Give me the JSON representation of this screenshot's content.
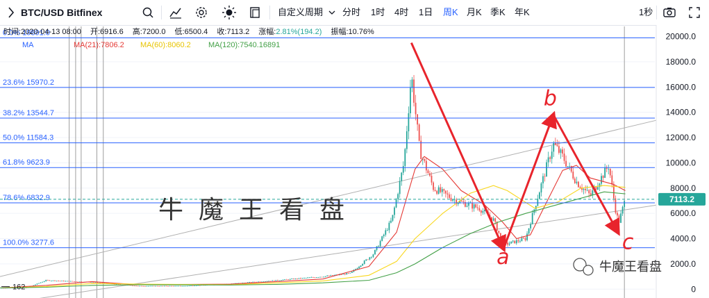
{
  "toolbar": {
    "symbol": "BTC/USD Bitfinex",
    "custom_period": "自定义周期",
    "periods": [
      "分时",
      "1时",
      "4时",
      "1日",
      "周K",
      "月K",
      "季K",
      "年K"
    ],
    "active_period": "周K",
    "interval": "1秒",
    "icons": [
      "search-icon",
      "indicator-icon",
      "settings-icon",
      "theme-icon",
      "layout-icon",
      "camera-icon",
      "fullscreen-icon"
    ]
  },
  "info_line": {
    "time_label": "时间:",
    "time": "2020-04-13 08:00",
    "open_label": "开:",
    "open": "6916.6",
    "high_label": "高:",
    "high": "7200.0",
    "low_label": "低:",
    "low": "6500.4",
    "close_label": "收:",
    "close": "7113.2",
    "change_label": "涨幅:",
    "change": "2.81%(194.2)",
    "amplitude_label": "振幅:",
    "amplitude": "10.76%"
  },
  "ma_line": {
    "ma": "MA",
    "ma21": "MA(21):7806.2",
    "ma60": "MA(60):8060.2",
    "ma120": "MA(120):7540.16891"
  },
  "watermark": "牛魔王看盘",
  "brand": "牛魔王看盘",
  "colors": {
    "up": "#26a69a",
    "down": "#ef5350",
    "fib": "#2962ff",
    "ma21": "#e53935",
    "ma60": "#f9d71c",
    "ma120": "#43a047",
    "arrow": "#e8242c",
    "price_tag": "#26a69a"
  },
  "chart_data": {
    "type": "candlestick",
    "title": "BTC/USD Bitfinex",
    "y_ticks": [
      0,
      2000,
      4000,
      6000,
      8000,
      10000,
      12000,
      14000,
      16000,
      18000,
      20000
    ],
    "y_tick_labels": [
      "0",
      "2000.0",
      "4000.0",
      "6000.0",
      "8000.0",
      "10000.0",
      "12000.0",
      "14000.0",
      "16000.0",
      "18000.0",
      "20000.0"
    ],
    "ylim": [
      -700,
      20800
    ],
    "xlim": [
      2013.5,
      2020.6
    ],
    "last_price": 7113.2,
    "last_price_label": "7113.2",
    "low_marker_label": "162",
    "fib_levels": [
      {
        "label": "0.0% 19891.0",
        "value": 19891.0
      },
      {
        "label": "23.6% 15970.2",
        "value": 15970.2
      },
      {
        "label": "38.2% 13544.7",
        "value": 13544.7
      },
      {
        "label": "50.0% 11584.3",
        "value": 11584.3
      },
      {
        "label": "61.8% 9623.9",
        "value": 9623.9
      },
      {
        "label": "78.6% 6832.9",
        "value": 6832.9
      },
      {
        "label": "100.0% 3277.6",
        "value": 3277.6
      }
    ],
    "waves": [
      {
        "label": "a",
        "from": [
          2017.96,
          19500
        ],
        "to": [
          2018.96,
          3200
        ]
      },
      {
        "label": "b",
        "from": [
          2018.96,
          3200
        ],
        "to": [
          2019.5,
          13800
        ]
      },
      {
        "label": "c",
        "from": [
          2019.5,
          13800
        ],
        "to": [
          2020.2,
          4500
        ]
      }
    ],
    "price_path": [
      [
        2013.5,
        100
      ],
      [
        2013.8,
        130
      ],
      [
        2014.0,
        700
      ],
      [
        2014.5,
        550
      ],
      [
        2015.0,
        250
      ],
      [
        2015.5,
        250
      ],
      [
        2016.0,
        430
      ],
      [
        2016.5,
        700
      ],
      [
        2017.0,
        1000
      ],
      [
        2017.3,
        1250
      ],
      [
        2017.55,
        2800
      ],
      [
        2017.75,
        5500
      ],
      [
        2017.88,
        10000
      ],
      [
        2017.96,
        17000
      ],
      [
        2018.05,
        11000
      ],
      [
        2018.2,
        8000
      ],
      [
        2018.45,
        7000
      ],
      [
        2018.7,
        6400
      ],
      [
        2018.85,
        5500
      ],
      [
        2018.96,
        3500
      ],
      [
        2019.2,
        4000
      ],
      [
        2019.35,
        7800
      ],
      [
        2019.5,
        11500
      ],
      [
        2019.6,
        10500
      ],
      [
        2019.75,
        8500
      ],
      [
        2019.9,
        7400
      ],
      [
        2020.0,
        8600
      ],
      [
        2020.1,
        9800
      ],
      [
        2020.18,
        6000
      ],
      [
        2020.21,
        5300
      ],
      [
        2020.28,
        7113.2
      ]
    ],
    "series": [
      {
        "name": "MA(21)",
        "color": "#e53935",
        "points": [
          [
            2013.5,
            100
          ],
          [
            2014.0,
            300
          ],
          [
            2014.5,
            600
          ],
          [
            2015.0,
            350
          ],
          [
            2016.0,
            400
          ],
          [
            2016.5,
            600
          ],
          [
            2017.0,
            800
          ],
          [
            2017.5,
            1800
          ],
          [
            2017.8,
            4500
          ],
          [
            2018.0,
            9500
          ],
          [
            2018.1,
            10500
          ],
          [
            2018.3,
            9500
          ],
          [
            2018.5,
            7800
          ],
          [
            2018.75,
            6700
          ],
          [
            2018.95,
            5300
          ],
          [
            2019.1,
            4000
          ],
          [
            2019.25,
            4300
          ],
          [
            2019.4,
            6500
          ],
          [
            2019.6,
            9400
          ],
          [
            2019.75,
            9800
          ],
          [
            2019.9,
            8800
          ],
          [
            2020.05,
            8500
          ],
          [
            2020.15,
            8300
          ],
          [
            2020.28,
            7800
          ]
        ]
      },
      {
        "name": "MA(60)",
        "color": "#f9d71c",
        "points": [
          [
            2013.5,
            100
          ],
          [
            2014.0,
            200
          ],
          [
            2014.5,
            450
          ],
          [
            2015.0,
            400
          ],
          [
            2016.0,
            350
          ],
          [
            2016.5,
            500
          ],
          [
            2017.0,
            650
          ],
          [
            2017.5,
            1100
          ],
          [
            2017.8,
            2200
          ],
          [
            2018.0,
            4000
          ],
          [
            2018.3,
            6000
          ],
          [
            2018.6,
            7600
          ],
          [
            2018.85,
            8200
          ],
          [
            2019.0,
            7800
          ],
          [
            2019.3,
            6400
          ],
          [
            2019.55,
            6900
          ],
          [
            2019.8,
            8000
          ],
          [
            2020.05,
            8200
          ],
          [
            2020.28,
            8060
          ]
        ]
      },
      {
        "name": "MA(120)",
        "color": "#43a047",
        "points": [
          [
            2013.5,
            100
          ],
          [
            2014.0,
            150
          ],
          [
            2014.5,
            300
          ],
          [
            2015.0,
            350
          ],
          [
            2016.0,
            330
          ],
          [
            2016.5,
            380
          ],
          [
            2017.0,
            500
          ],
          [
            2017.5,
            700
          ],
          [
            2017.8,
            1300
          ],
          [
            2018.0,
            2000
          ],
          [
            2018.3,
            3300
          ],
          [
            2018.6,
            4400
          ],
          [
            2018.9,
            5300
          ],
          [
            2019.2,
            6000
          ],
          [
            2019.5,
            6600
          ],
          [
            2019.8,
            7200
          ],
          [
            2020.05,
            7700
          ],
          [
            2020.28,
            7540
          ]
        ]
      }
    ]
  }
}
